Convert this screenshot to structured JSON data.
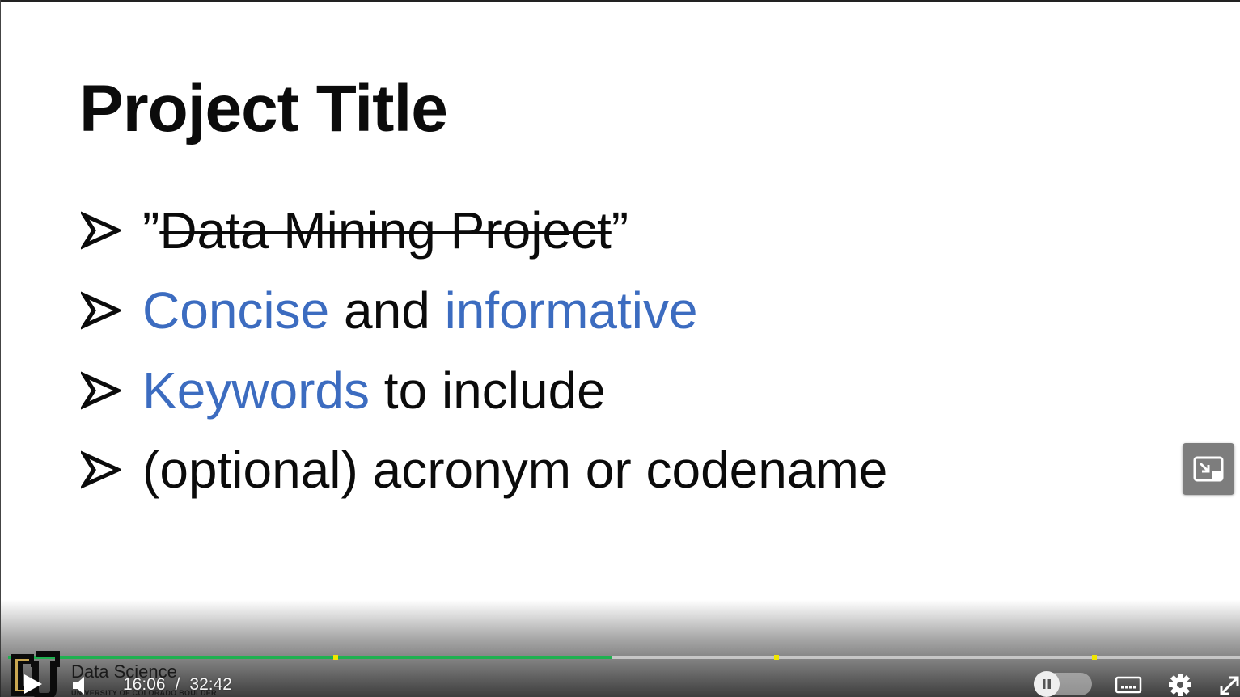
{
  "slide": {
    "title": "Project Title",
    "bullets": [
      {
        "open_quote": "”",
        "struck": "Data Mining Project",
        "close_quote": "”"
      },
      {
        "part1": "Concise",
        "part2": " and ",
        "part3": "informative"
      },
      {
        "part1": "Keywords",
        "part2": " to include"
      },
      {
        "text": "(optional) acronym or codename"
      }
    ]
  },
  "player": {
    "brand_name": "Data Science",
    "brand_sub": "UNIVERSITY OF COLORADO BOULDER",
    "current_time": "16:06",
    "separator": "/",
    "duration": "32:42",
    "progress_fraction": 0.49,
    "chapter_markers": [
      0.266,
      0.624,
      0.882
    ],
    "progress_color": "#1fb150",
    "marker_color": "#f0e600",
    "accent_blue": "#3c6cc0",
    "icons": [
      "play-icon",
      "volume-icon",
      "pause-icon",
      "captions-icon",
      "gear-icon",
      "fullscreen-icon",
      "picture-in-picture-icon"
    ]
  }
}
